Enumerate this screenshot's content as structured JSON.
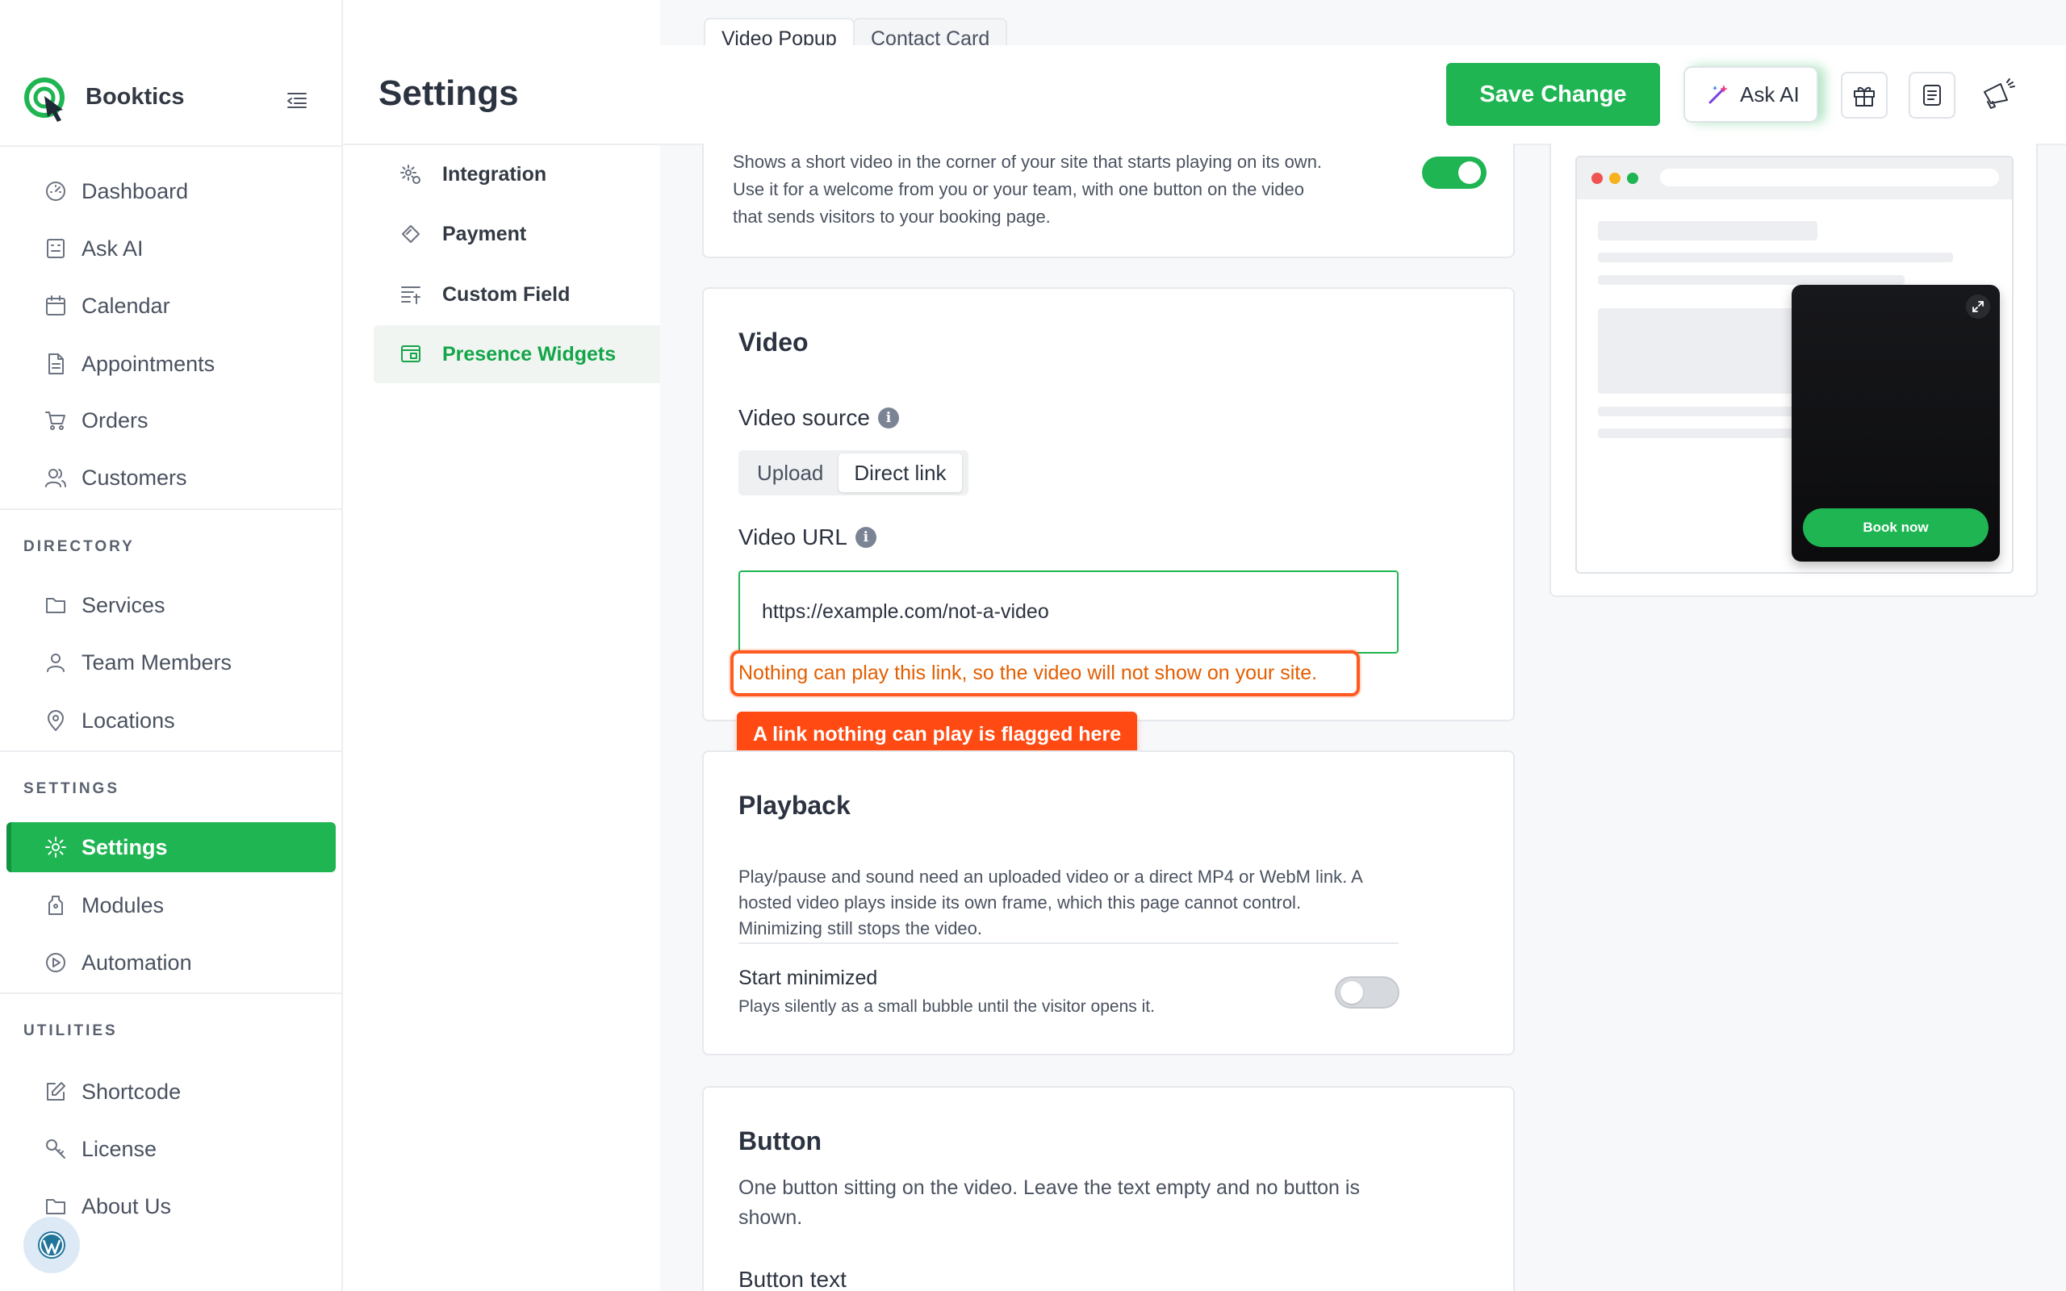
{
  "app": {
    "name": "Booktics"
  },
  "header": {
    "title": "Settings",
    "save_label": "Save Change",
    "ask_ai_label": "Ask AI"
  },
  "top_tabs": [
    {
      "label": "Video Popup"
    },
    {
      "label": "Contact Card"
    }
  ],
  "sidebar": {
    "main": [
      {
        "label": "Dashboard",
        "icon": "dashboard-icon"
      },
      {
        "label": "Ask AI",
        "icon": "robot-icon"
      },
      {
        "label": "Calendar",
        "icon": "calendar-icon"
      },
      {
        "label": "Appointments",
        "icon": "document-icon"
      },
      {
        "label": "Orders",
        "icon": "cart-icon"
      },
      {
        "label": "Customers",
        "icon": "users-icon"
      }
    ],
    "directory_title": "DIRECTORY",
    "directory": [
      {
        "label": "Services",
        "icon": "folder-icon"
      },
      {
        "label": "Team Members",
        "icon": "user-icon"
      },
      {
        "label": "Locations",
        "icon": "location-pin-icon"
      }
    ],
    "settings_title": "SETTINGS",
    "settings": [
      {
        "label": "Settings",
        "icon": "gear-icon"
      },
      {
        "label": "Modules",
        "icon": "tag-icon"
      },
      {
        "label": "Automation",
        "icon": "play-circle-icon"
      }
    ],
    "utilities_title": "UTILITIES",
    "utilities": [
      {
        "label": "Shortcode",
        "icon": "edit-icon"
      },
      {
        "label": "License",
        "icon": "key-icon"
      },
      {
        "label": "About Us",
        "icon": "folder-icon"
      }
    ]
  },
  "subnav": {
    "items": [
      {
        "label": "Integration",
        "icon": "integration-gear-icon"
      },
      {
        "label": "Payment",
        "icon": "payment-icon"
      },
      {
        "label": "Custom Field",
        "icon": "custom-field-icon"
      },
      {
        "label": "Presence Widgets",
        "icon": "widget-icon"
      }
    ],
    "active": "Presence Widgets"
  },
  "intro_card": {
    "text_lines": [
      "Shows a short video in the corner of your site that starts playing on its own.",
      "Use it for a welcome from you or your team, with one button on the video",
      "that sends visitors to your booking page."
    ],
    "enabled": true
  },
  "video_card": {
    "title": "Video",
    "source_label": "Video source",
    "source_options": [
      "Upload",
      "Direct link"
    ],
    "source_selected": "Direct link",
    "url_label": "Video URL",
    "url_value": "https://example.com/not-a-video",
    "error_text": "Nothing can play this link, so the video will not show on your site.",
    "flag_label": "A link nothing can play is flagged here"
  },
  "playback_card": {
    "title": "Playback",
    "text_lines": [
      "Play/pause and sound need an uploaded video or a direct MP4 or WebM link. A",
      "hosted video plays inside its own frame, which this page cannot control.",
      "Minimizing still stops the video."
    ],
    "start_min_label": "Start minimized",
    "start_min_desc": "Plays silently as a small bubble until the visitor opens it.",
    "start_min_enabled": false
  },
  "button_card": {
    "title": "Button",
    "text_lines": [
      "One button sitting on the video. Leave the text empty and no button is",
      "shown."
    ],
    "button_text_label": "Button text"
  },
  "preview": {
    "book_label": "Book now"
  },
  "colors": {
    "brand_green": "#1fb553",
    "error_orange": "#ff4b13"
  }
}
